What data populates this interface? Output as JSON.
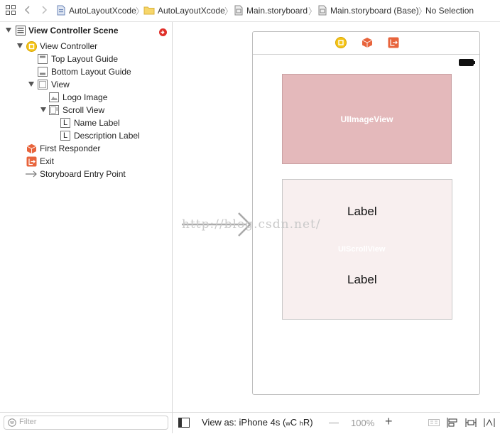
{
  "breadcrumbs": {
    "project": "AutoLayoutXcode",
    "folder": "AutoLayoutXcode",
    "storyboard": "Main.storyboard",
    "storyboard_base": "Main.storyboard (Base)",
    "selection": "No Selection"
  },
  "outline": {
    "scene": "View Controller Scene",
    "view_controller": "View Controller",
    "top_layout_guide": "Top Layout Guide",
    "bottom_layout_guide": "Bottom Layout Guide",
    "view": "View",
    "logo_image": "Logo Image",
    "scroll_view": "Scroll View",
    "name_label": "Name Label",
    "description_label": "Description Label",
    "first_responder": "First Responder",
    "exit": "Exit",
    "entry_point": "Storyboard Entry Point",
    "label_glyph": "L"
  },
  "canvas": {
    "image_view_label": "UIImageView",
    "scroll_view_label_faint": "UIScrollView",
    "label_top": "Label",
    "label_bottom": "Label",
    "watermark": "http://blog.csdn.net/"
  },
  "bottom": {
    "filter_placeholder": "Filter",
    "view_as_prefix": "View as: iPhone 4s (",
    "size_w": "w",
    "size_c": "C",
    "size_h": "h",
    "size_r": "R",
    "size_suffix": ")",
    "zoom": "100%",
    "minus": "—",
    "plus": "+"
  },
  "colors": {
    "image_view_fill": "#e4b9bb",
    "scroll_view_fill": "#f8efef",
    "vc_icon": "#f5c518",
    "orange_icon": "#e8643c",
    "red_badge": "#e0302a"
  }
}
